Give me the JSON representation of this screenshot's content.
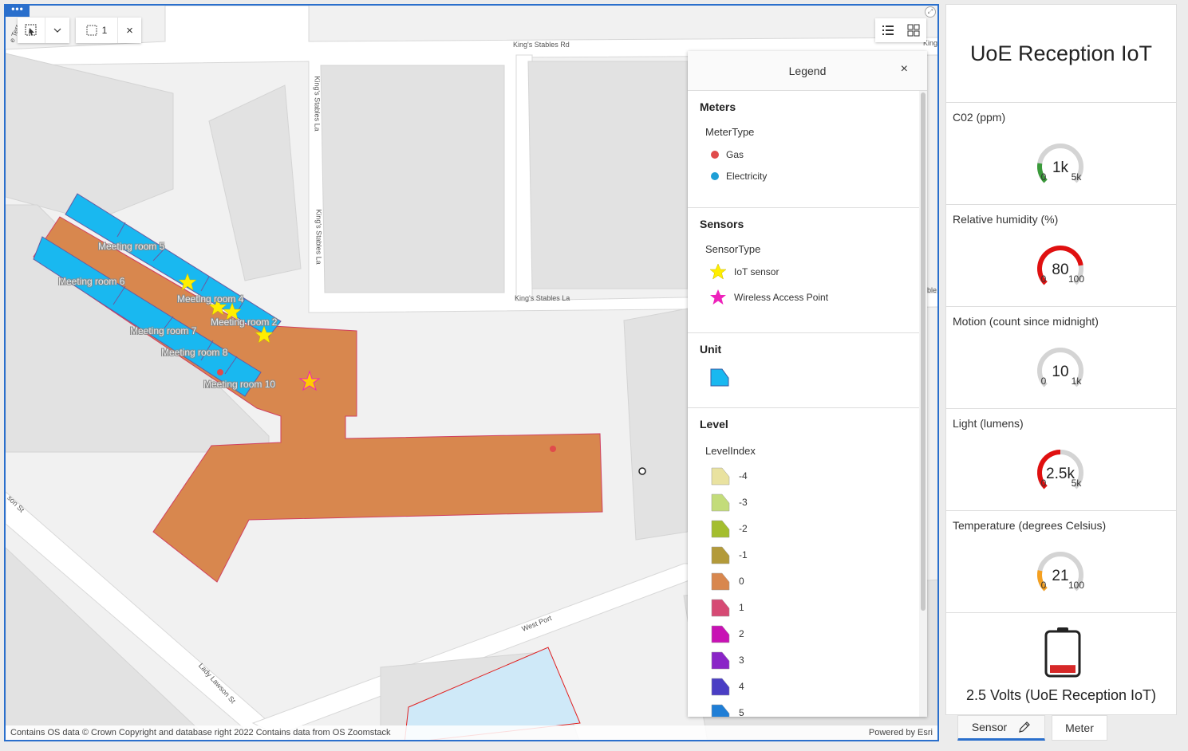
{
  "map": {
    "roads": {
      "kings_stables_rd": "King's Stables Rd",
      "kings_stables_la_v": "King's Stables La",
      "kings_stables_la_v2": "King's Stables La",
      "kings_stables_la_h": "King's Stables La",
      "west_port": "West Port",
      "lady_lawson": "Lady Lawson St",
      "lawson_edge": "son St",
      "terr_edge": "e Terr",
      "king_edge": "King",
      "stable_edge": "able"
    },
    "rooms": [
      "Meeting room 5",
      "Meeting room 6",
      "Meeting room 4",
      "Meeting room 2",
      "Meeting room 7",
      "Meeting room 8",
      "Meeting room 10"
    ],
    "attribution": "Contains OS data © Crown Copyright and database right 2022 Contains data from OS Zoomstack",
    "powered_by": "Powered by Esri",
    "toolbar": {
      "menu_dots": "•••",
      "selection_count": "1",
      "clear": "×"
    }
  },
  "legend": {
    "title": "Legend",
    "close": "×",
    "sections": {
      "meters": {
        "title": "Meters",
        "field": "MeterType",
        "items": [
          {
            "label": "Gas",
            "color": "#e04b4b"
          },
          {
            "label": "Electricity",
            "color": "#1f9fd6"
          }
        ]
      },
      "sensors": {
        "title": "Sensors",
        "field": "SensorType",
        "items": [
          {
            "label": "IoT sensor",
            "color": "#ffee00"
          },
          {
            "label": "Wireless Access Point",
            "color": "#ee22bb"
          }
        ]
      },
      "unit": {
        "title": "Unit",
        "color": "#19b8f0"
      },
      "level": {
        "title": "Level",
        "field": "LevelIndex",
        "items": [
          {
            "label": "-4",
            "color": "#e9e2a0"
          },
          {
            "label": "-3",
            "color": "#c3dc7a"
          },
          {
            "label": "-2",
            "color": "#a4be2e"
          },
          {
            "label": "-1",
            "color": "#b39a3a"
          },
          {
            "label": "0",
            "color": "#d8874e"
          },
          {
            "label": "1",
            "color": "#d64a74"
          },
          {
            "label": "2",
            "color": "#c812b4"
          },
          {
            "label": "3",
            "color": "#8a25c7"
          },
          {
            "label": "4",
            "color": "#4a3ec4"
          },
          {
            "label": "5",
            "color": "#1f7ed6"
          }
        ]
      }
    }
  },
  "panel": {
    "title": "UoE Reception IoT",
    "gauges": [
      {
        "label": "C02 (ppm)",
        "value_text": "1k",
        "min": "0",
        "max": "5k",
        "value": 1000,
        "max_value": 5000,
        "color": "#3a9a3a"
      },
      {
        "label": "Relative humidity (%)",
        "value_text": "80",
        "min": "0",
        "max": "100",
        "value": 80,
        "max_value": 100,
        "color": "#e01010"
      },
      {
        "label": "Motion (count since midnight)",
        "value_text": "10",
        "min": "0",
        "max": "1k",
        "value": 10,
        "max_value": 1000,
        "color": "#cccccc"
      },
      {
        "label": "Light (lumens)",
        "value_text": "2.5k",
        "min": "0",
        "max": "5k",
        "value": 2500,
        "max_value": 5000,
        "color": "#e01010"
      },
      {
        "label": "Temperature (degrees Celsius)",
        "value_text": "21",
        "min": "0",
        "max": "100",
        "value": 21,
        "max_value": 100,
        "color": "#f5a020"
      }
    ],
    "battery": {
      "label": "2.5 Volts (UoE Reception IoT)",
      "level": 0.2,
      "color": "#d62828"
    }
  },
  "tabs": [
    {
      "label": "Sensor"
    },
    {
      "label": "Meter"
    }
  ]
}
